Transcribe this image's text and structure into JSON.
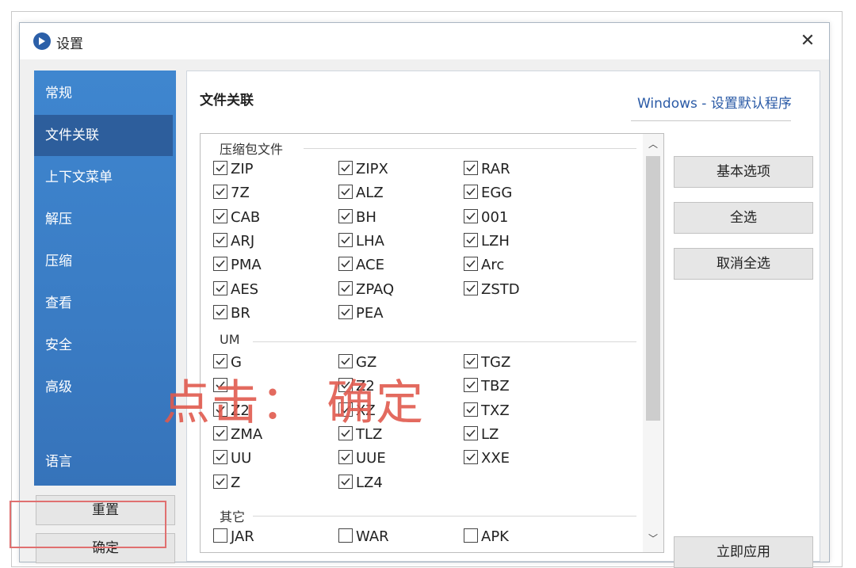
{
  "window": {
    "title": "设置",
    "close": "✕"
  },
  "sidebar": {
    "items": [
      {
        "label": "常规"
      },
      {
        "label": "文件关联"
      },
      {
        "label": "上下文菜单"
      },
      {
        "label": "解压"
      },
      {
        "label": "压缩"
      },
      {
        "label": "查看"
      },
      {
        "label": "安全"
      },
      {
        "label": "高级"
      },
      {
        "label": "语言"
      }
    ],
    "active_index": 1,
    "reset_label": "重置",
    "ok_label": "确定"
  },
  "main": {
    "section_title": "文件关联",
    "windows_link": "Windows - 设置默认程序",
    "groups": [
      {
        "label": "压缩包文件",
        "rows": [
          [
            {
              "label": "ZIP",
              "checked": true
            },
            {
              "label": "ZIPX",
              "checked": true
            },
            {
              "label": "RAR",
              "checked": true
            }
          ],
          [
            {
              "label": "7Z",
              "checked": true
            },
            {
              "label": "ALZ",
              "checked": true
            },
            {
              "label": "EGG",
              "checked": true
            }
          ],
          [
            {
              "label": "CAB",
              "checked": true
            },
            {
              "label": "BH",
              "checked": true
            },
            {
              "label": "001",
              "checked": true
            }
          ],
          [
            {
              "label": "ARJ",
              "checked": true
            },
            {
              "label": "LHA",
              "checked": true
            },
            {
              "label": "LZH",
              "checked": true
            }
          ],
          [
            {
              "label": "PMA",
              "checked": true
            },
            {
              "label": "ACE",
              "checked": true
            },
            {
              "label": "Arc",
              "checked": true
            }
          ],
          [
            {
              "label": "AES",
              "checked": true
            },
            {
              "label": "ZPAQ",
              "checked": true
            },
            {
              "label": "ZSTD",
              "checked": true
            }
          ],
          [
            {
              "label": "BR",
              "checked": true
            },
            {
              "label": "PEA",
              "checked": true
            }
          ]
        ]
      },
      {
        "label": "UM",
        "rows": [
          [
            {
              "label": "G",
              "checked": true
            },
            {
              "label": "GZ",
              "checked": true
            },
            {
              "label": "TGZ",
              "checked": true
            }
          ],
          [
            {
              "label": "",
              "checked": true
            },
            {
              "label": "Z2",
              "checked": true
            },
            {
              "label": "TBZ",
              "checked": true
            }
          ],
          [
            {
              "label": "Z2",
              "checked": true
            },
            {
              "label": "XZ",
              "checked": true
            },
            {
              "label": "TXZ",
              "checked": true
            }
          ],
          [
            {
              "label": "ZMA",
              "checked": true
            },
            {
              "label": "TLZ",
              "checked": true
            },
            {
              "label": "LZ",
              "checked": true
            }
          ],
          [
            {
              "label": "UU",
              "checked": true
            },
            {
              "label": "UUE",
              "checked": true
            },
            {
              "label": "XXE",
              "checked": true
            }
          ],
          [
            {
              "label": "Z",
              "checked": true
            },
            {
              "label": "LZ4",
              "checked": true
            }
          ]
        ]
      },
      {
        "label": "其它",
        "rows": [
          [
            {
              "label": "JAR",
              "checked": false
            },
            {
              "label": "WAR",
              "checked": false
            },
            {
              "label": "APK",
              "checked": false
            }
          ]
        ]
      }
    ],
    "buttons": {
      "basic": "基本选项",
      "select_all": "全选",
      "deselect_all": "取消全选",
      "apply": "立即应用"
    }
  },
  "overlay_text": "点击： 确定",
  "colors": {
    "sidebar": "#3f86cf",
    "sidebar_active": "#2d5e9c",
    "link": "#2a5aa6",
    "overlay": "#e05a4e"
  }
}
